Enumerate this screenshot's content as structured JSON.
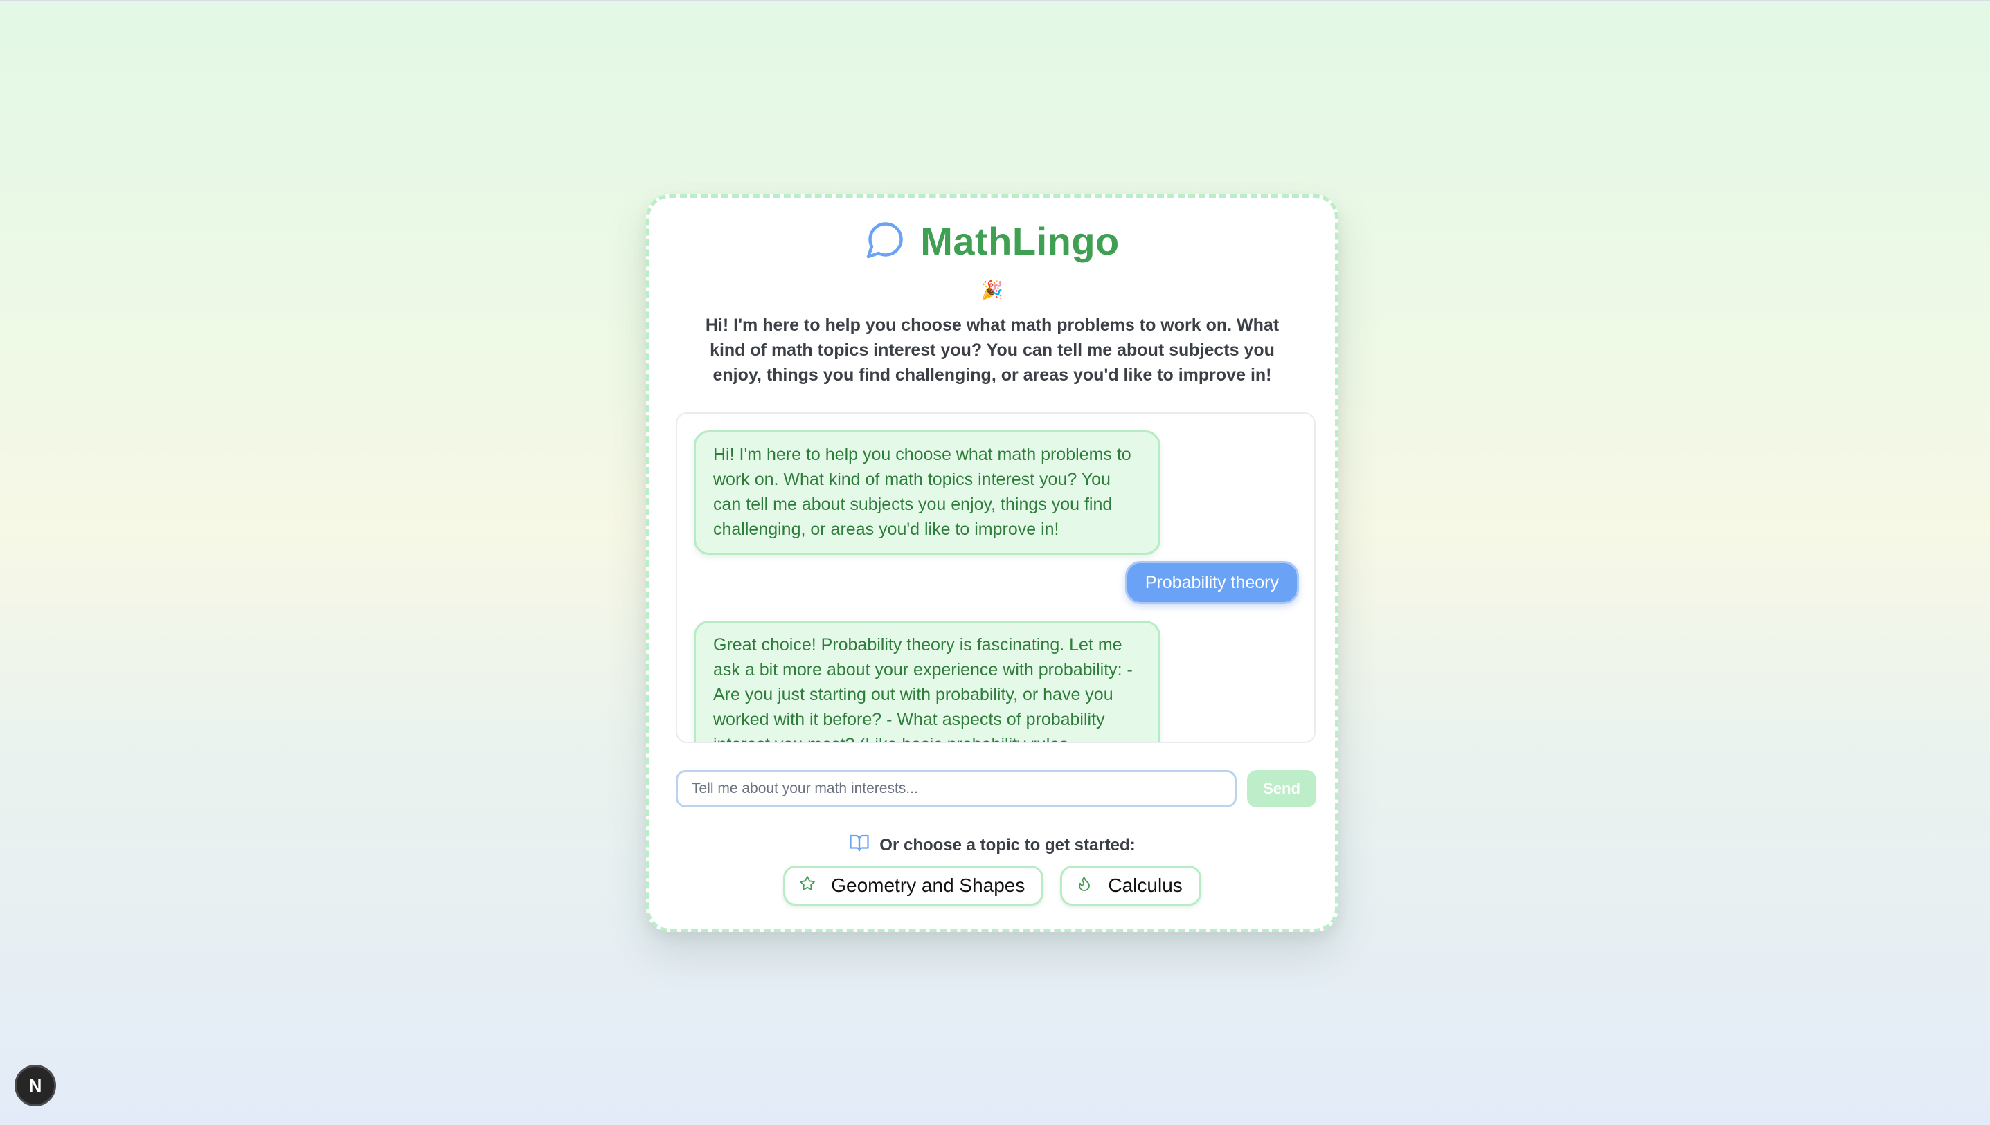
{
  "app": {
    "title": "MathLingo",
    "emoji": "🎉",
    "intro": "Hi! I'm here to help you choose what math problems to work on. What kind of math topics interest you? You can tell me about subjects you enjoy, things you find challenging, or areas you'd like to improve in!"
  },
  "chat": {
    "messages": [
      {
        "role": "assistant",
        "text": "Hi! I'm here to help you choose what math problems to work on. What kind of math topics interest you? You can tell me about subjects you enjoy, things you find challenging, or areas you'd like to improve in!"
      },
      {
        "role": "user",
        "text": "Probability theory"
      },
      {
        "role": "assistant",
        "text": "Great choice! Probability theory is fascinating. Let me ask a bit more about your experience with probability: - Are you just starting out with probability, or have you worked with it before? - What aspects of probability interest you most? (Like basic probability rules,"
      }
    ]
  },
  "composer": {
    "placeholder": "Tell me about your math interests...",
    "send_label": "Send"
  },
  "topics": {
    "heading": "Or choose a topic to get started:",
    "items": [
      {
        "label": "Geometry and Shapes",
        "icon": "star-icon"
      },
      {
        "label": "Calculus",
        "icon": "flame-icon"
      }
    ]
  },
  "badge": {
    "label": "N"
  },
  "colors": {
    "brand_green": "#3f9f52",
    "bubble_bg": "#e5f9e9",
    "user_bubble": "#6aa3f5",
    "icon_blue": "#6aa3f5"
  }
}
